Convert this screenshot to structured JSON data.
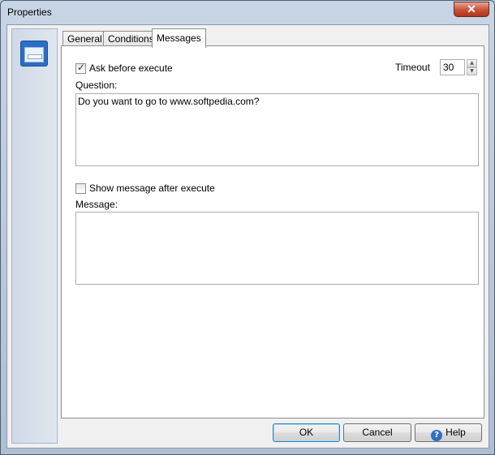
{
  "window": {
    "title": "Properties",
    "close_glyph": "✕"
  },
  "tabs": [
    {
      "label": "General"
    },
    {
      "label": "Conditions"
    },
    {
      "label": "Messages",
      "active": true
    }
  ],
  "messages": {
    "ask_before_execute": {
      "label": "Ask before execute",
      "checked": true
    },
    "timeout": {
      "label": "Timeout",
      "value": "30"
    },
    "question": {
      "label": "Question:",
      "value": "Do you want to go to www.softpedia.com?"
    },
    "show_message_after_execute": {
      "label": "Show message after execute",
      "checked": false
    },
    "message": {
      "label": "Message:",
      "value": ""
    }
  },
  "buttons": {
    "ok": "OK",
    "cancel": "Cancel",
    "help": "Help"
  },
  "icons": {
    "window_icon": "window-icon",
    "help_icon_glyph": "?",
    "spin_up": "▲",
    "spin_down": "▼"
  }
}
